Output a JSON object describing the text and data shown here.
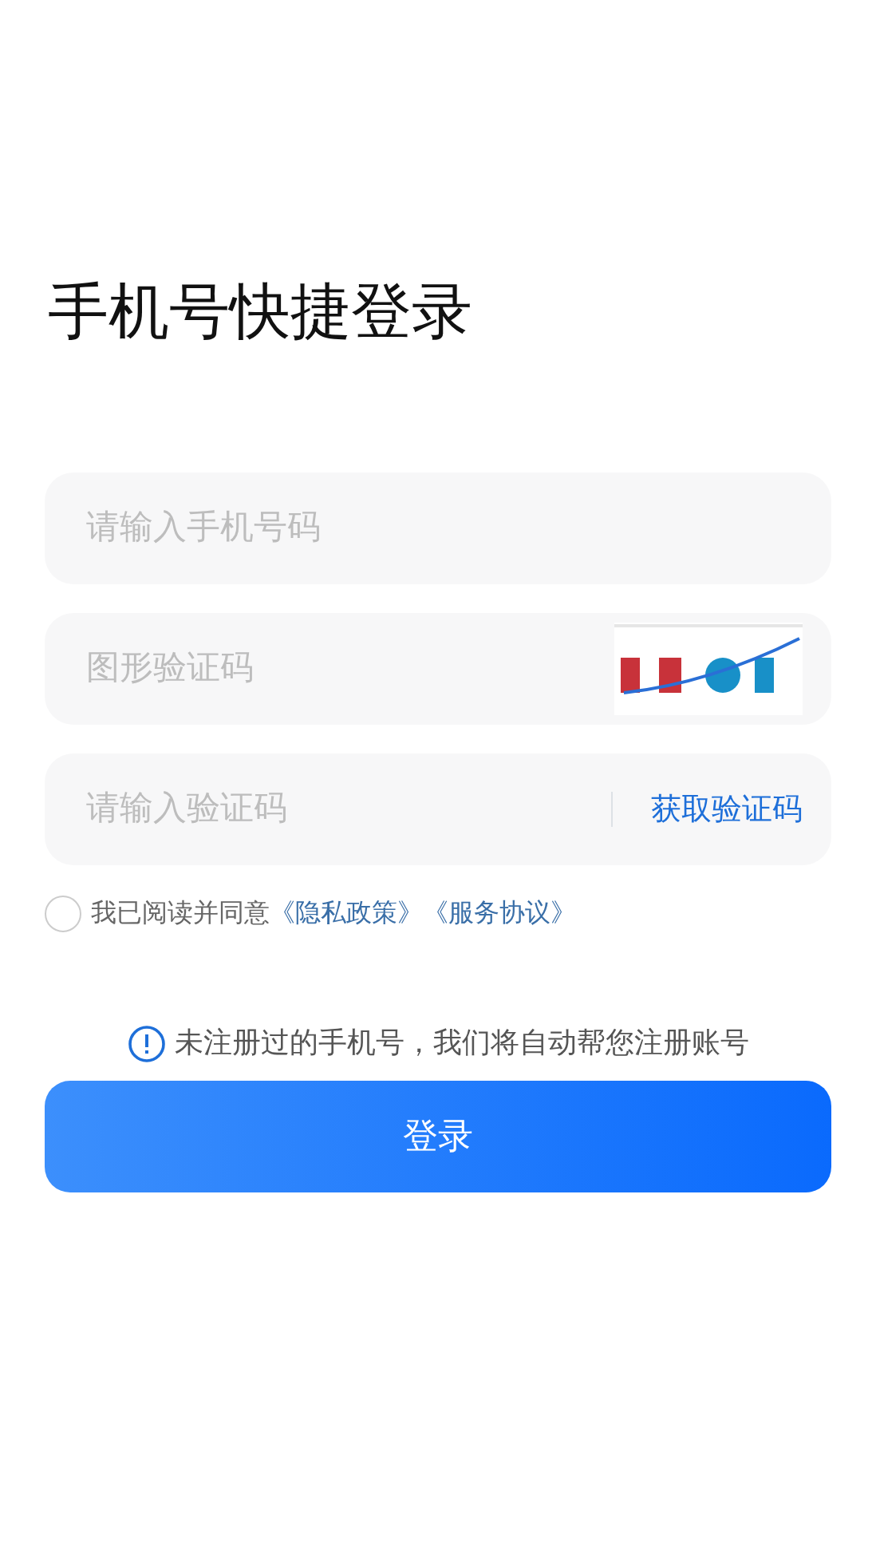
{
  "title": "手机号快捷登录",
  "fields": [
    {
      "kind": "text",
      "placeholder": "请输入手机号码"
    },
    {
      "kind": "captcha",
      "placeholder": "图形验证码"
    },
    {
      "kind": "code",
      "placeholder": "请输入验证码",
      "action": "获取验证码"
    }
  ],
  "agreement": {
    "checked": false,
    "text": "我已阅读并同意",
    "links": [
      "《隐私政策》",
      "《服务协议》"
    ]
  },
  "notice": "未注册过的手机号，我们将自动帮您注册账号",
  "login_button": "登录"
}
